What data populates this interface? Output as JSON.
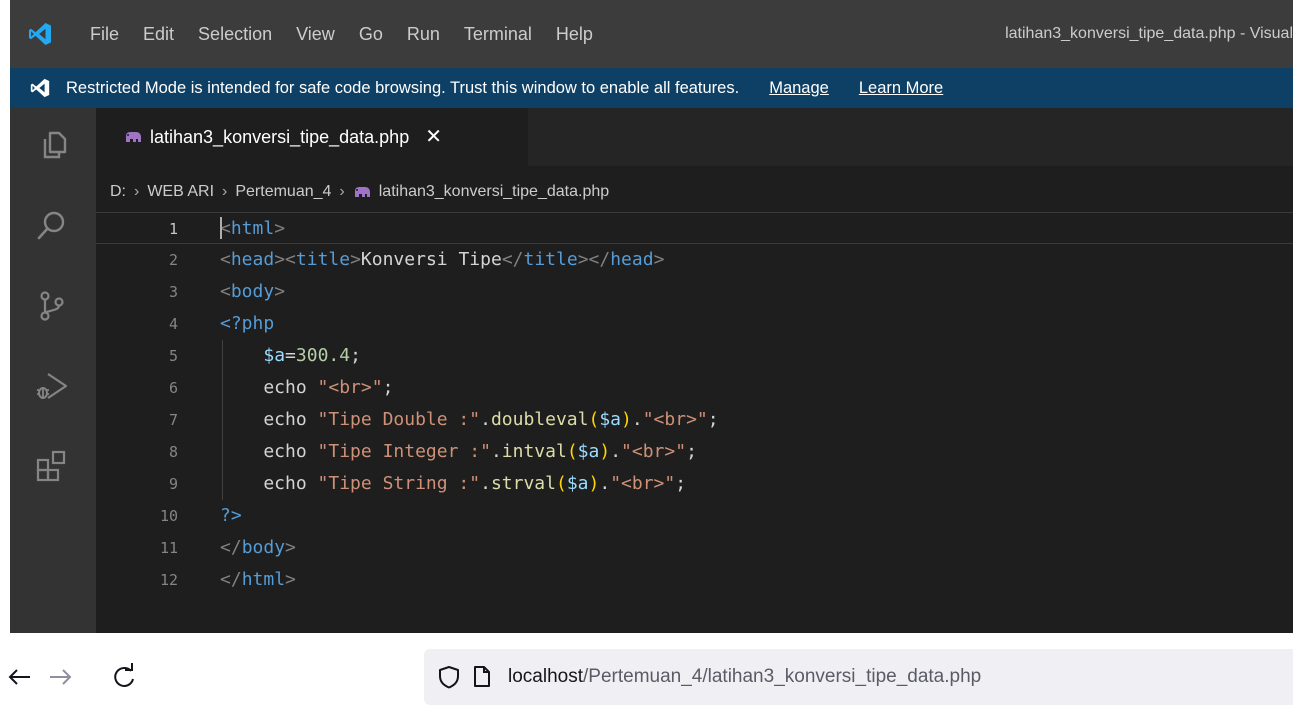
{
  "editor_window": {
    "menu": [
      "File",
      "Edit",
      "Selection",
      "View",
      "Go",
      "Run",
      "Terminal",
      "Help"
    ],
    "title": "latihan3_konversi_tipe_data.php - Visual",
    "banner": {
      "message": "Restricted Mode is intended for safe code browsing. Trust this window to enable all features.",
      "manage_label": "Manage",
      "learn_more_label": "Learn More"
    },
    "activity_bar": [
      "explorer-icon",
      "search-icon",
      "source-control-icon",
      "run-debug-icon",
      "extensions-icon"
    ],
    "tab": {
      "label": "latihan3_konversi_tipe_data.php",
      "close_glyph": "✕",
      "icon": "php-elephant-icon"
    },
    "breadcrumb": [
      "D:",
      "WEB ARI",
      "Pertemuan_4",
      "latihan3_konversi_tipe_data.php"
    ],
    "breadcrumb_separator": "›",
    "code_lines": [
      {
        "n": "1",
        "tokens": [
          [
            "<",
            "punc"
          ],
          [
            "html",
            "tag"
          ],
          [
            ">",
            "punc"
          ]
        ]
      },
      {
        "n": "2",
        "tokens": [
          [
            "<",
            "punc"
          ],
          [
            "head",
            "tag"
          ],
          [
            "><",
            "punc"
          ],
          [
            "title",
            "tag"
          ],
          [
            ">",
            "punc"
          ],
          [
            "Konversi Tipe",
            "text"
          ],
          [
            "</",
            "punc"
          ],
          [
            "title",
            "tag"
          ],
          [
            "></",
            "punc"
          ],
          [
            "head",
            "tag"
          ],
          [
            ">",
            "punc"
          ]
        ]
      },
      {
        "n": "3",
        "tokens": [
          [
            "<",
            "punc"
          ],
          [
            "body",
            "tag"
          ],
          [
            ">",
            "punc"
          ]
        ]
      },
      {
        "n": "4",
        "tokens": [
          [
            "<?php",
            "tag"
          ]
        ]
      },
      {
        "n": "5",
        "tokens": [
          [
            "    ",
            "text"
          ],
          [
            "$a",
            "var"
          ],
          [
            "=",
            "text"
          ],
          [
            "300.4",
            "num"
          ],
          [
            ";",
            "text"
          ]
        ]
      },
      {
        "n": "6",
        "tokens": [
          [
            "    echo ",
            "kw"
          ],
          [
            "\"<br>\"",
            "str"
          ],
          [
            ";",
            "text"
          ]
        ]
      },
      {
        "n": "7",
        "tokens": [
          [
            "    echo ",
            "kw"
          ],
          [
            "\"Tipe Double :\"",
            "str"
          ],
          [
            ".",
            "text"
          ],
          [
            "doubleval",
            "fn"
          ],
          [
            "(",
            "paren"
          ],
          [
            "$a",
            "var"
          ],
          [
            ")",
            "paren"
          ],
          [
            ".",
            "text"
          ],
          [
            "\"<br>\"",
            "str"
          ],
          [
            ";",
            "text"
          ]
        ]
      },
      {
        "n": "8",
        "tokens": [
          [
            "    echo ",
            "kw"
          ],
          [
            "\"Tipe Integer :\"",
            "str"
          ],
          [
            ".",
            "text"
          ],
          [
            "intval",
            "fn"
          ],
          [
            "(",
            "paren"
          ],
          [
            "$a",
            "var"
          ],
          [
            ")",
            "paren"
          ],
          [
            ".",
            "text"
          ],
          [
            "\"<br>\"",
            "str"
          ],
          [
            ";",
            "text"
          ]
        ]
      },
      {
        "n": "9",
        "tokens": [
          [
            "    echo ",
            "kw"
          ],
          [
            "\"Tipe String :\"",
            "str"
          ],
          [
            ".",
            "text"
          ],
          [
            "strval",
            "fn"
          ],
          [
            "(",
            "paren"
          ],
          [
            "$a",
            "var"
          ],
          [
            ")",
            "paren"
          ],
          [
            ".",
            "text"
          ],
          [
            "\"<br>\"",
            "str"
          ],
          [
            ";",
            "text"
          ]
        ]
      },
      {
        "n": "10",
        "tokens": [
          [
            "?>",
            "tag"
          ]
        ]
      },
      {
        "n": "11",
        "tokens": [
          [
            "</",
            "punc"
          ],
          [
            "body",
            "tag"
          ],
          [
            ">",
            "punc"
          ]
        ]
      },
      {
        "n": "12",
        "tokens": [
          [
            "</",
            "punc"
          ],
          [
            "html",
            "tag"
          ],
          [
            ">",
            "punc"
          ]
        ]
      }
    ],
    "active_line": "1"
  },
  "browser": {
    "back_glyph": "←",
    "forward_glyph": "→",
    "url_host": "localhost",
    "url_path": "/Pertemuan_4/latihan3_konversi_tipe_data.php"
  },
  "colors": {
    "titlebar": "#3c3c3c",
    "banner": "#0e3f64",
    "editor_bg": "#1e1e1e",
    "vscode_blue": "#23a9f2",
    "php_icon": "#a074c4"
  }
}
